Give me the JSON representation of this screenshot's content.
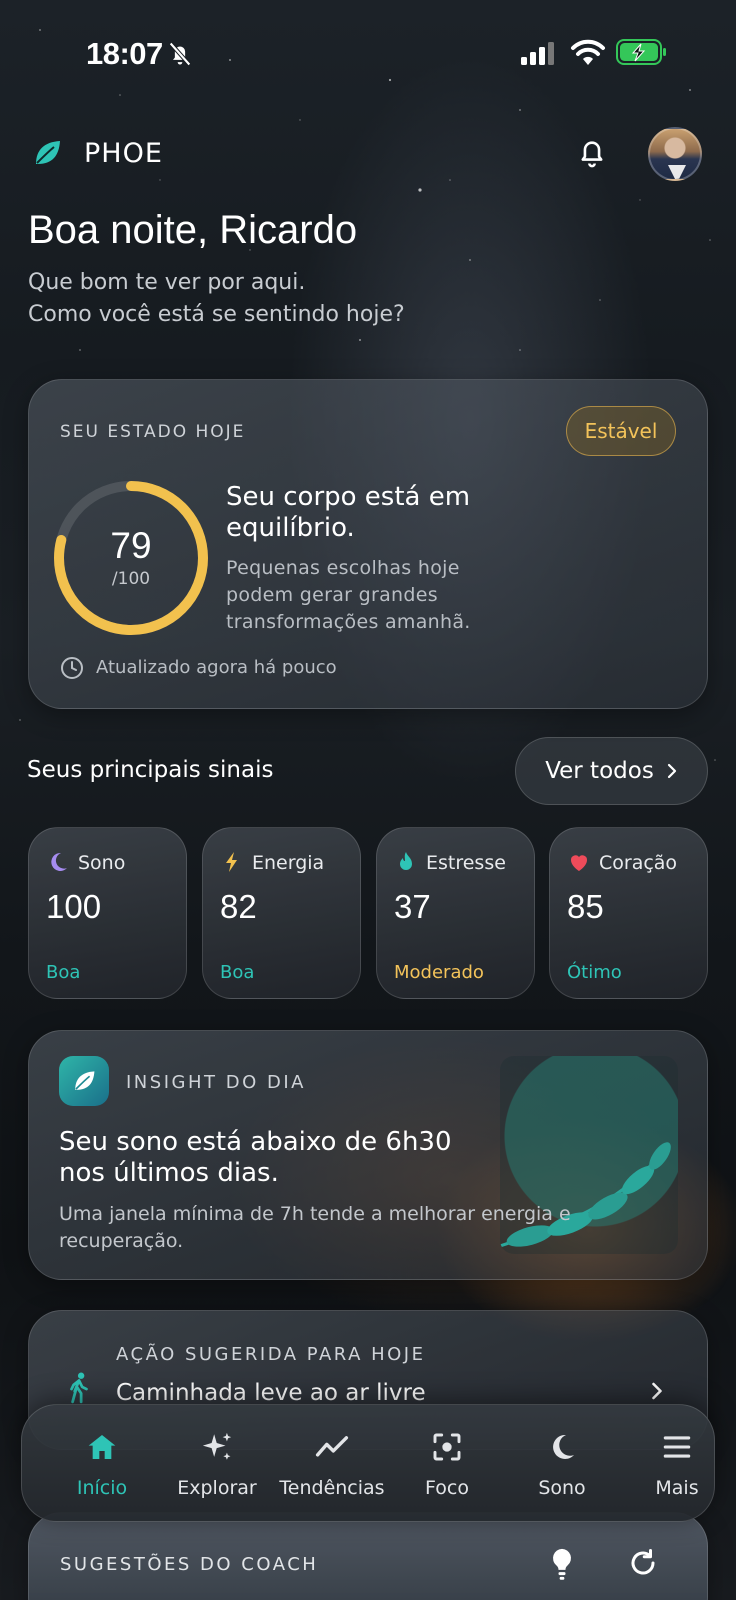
{
  "status_bar": {
    "time": "18:07"
  },
  "header": {
    "brand": "PHOE"
  },
  "greeting": {
    "title": "Boa noite, Ricardo",
    "line1": "Que bom te ver por aqui.",
    "line2": "Como você está se sentindo hoje?"
  },
  "state": {
    "label": "SEU ESTADO HOJE",
    "badge": "Estável",
    "score": "79",
    "score_max": "/100",
    "score_fraction": 0.79,
    "title": "Seu corpo está em equilíbrio.",
    "description": "Pequenas escolhas hoje podem gerar grandes transformações amanhã.",
    "updated": "Atualizado agora há pouco"
  },
  "signals": {
    "title": "Seus principais sinais",
    "see_all": "Ver todos",
    "items": [
      {
        "label": "Sono",
        "value": "100",
        "status": "Boa",
        "status_color": "#2ec4b6",
        "icon": "moon-icon"
      },
      {
        "label": "Energia",
        "value": "82",
        "status": "Boa",
        "status_color": "#2ec4b6",
        "icon": "bolt-icon"
      },
      {
        "label": "Estresse",
        "value": "37",
        "status": "Moderado",
        "status_color": "#f3c35a",
        "icon": "flame-icon"
      },
      {
        "label": "Coração",
        "value": "85",
        "status": "Ótimo",
        "status_color": "#2ec4b6",
        "icon": "heart-icon"
      }
    ]
  },
  "insight": {
    "label": "INSIGHT DO DIA",
    "title": "Seu sono está abaixo de 6h30 nos últimos dias.",
    "description": "Uma janela mínima de 7h tende a melhorar energia e recuperação."
  },
  "action": {
    "label": "AÇÃO SUGERIDA PARA HOJE",
    "text": "Caminhada leve ao ar livre"
  },
  "coach": {
    "label": "SUGESTÕES DO COACH"
  },
  "nav": {
    "items": [
      {
        "label": "Início",
        "active": true
      },
      {
        "label": "Explorar",
        "active": false
      },
      {
        "label": "Tendências",
        "active": false
      },
      {
        "label": "Foco",
        "active": false
      },
      {
        "label": "Sono",
        "active": false
      },
      {
        "label": "Mais",
        "active": false
      }
    ]
  },
  "colors": {
    "accent": "#2ec4b6",
    "score_ring": "#f2c14e",
    "warning": "#f3c35a",
    "battery": "#34c759"
  }
}
